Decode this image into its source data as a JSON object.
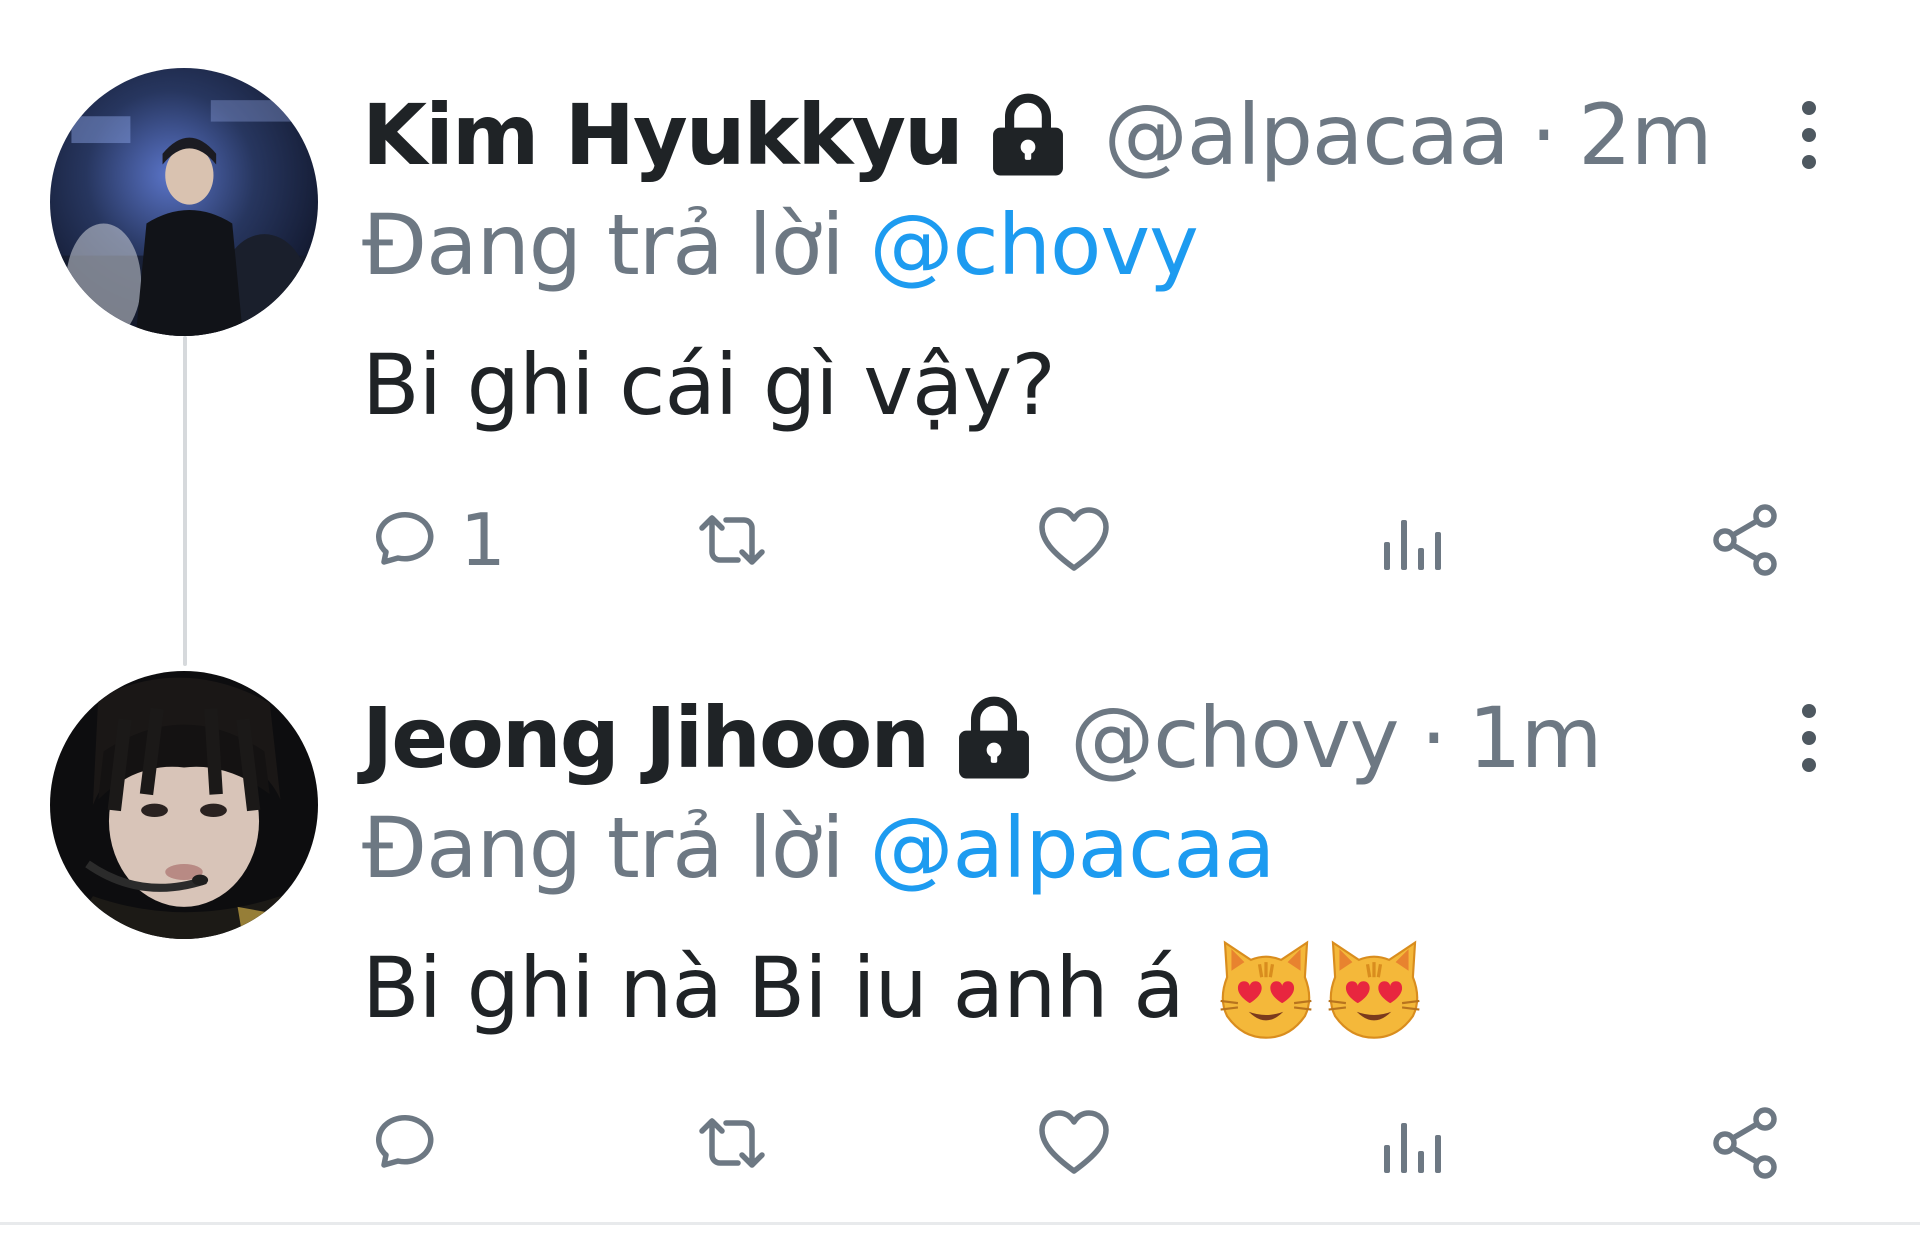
{
  "tweets": [
    {
      "display_name": "Kim Hyukkyu",
      "handle": "@alpacaa",
      "separator": "·",
      "time": "2m",
      "reply_prefix": "Đang trả lời",
      "reply_to": "@chovy",
      "text": "Bi ghi cái gì vậy?",
      "emoji": [],
      "reply_count": "1",
      "icons": [
        "lock-icon",
        "more-vertical-icon",
        "reply-icon",
        "retweet-icon",
        "like-icon",
        "views-icon",
        "share-icon"
      ]
    },
    {
      "display_name": "Jeong Jihoon",
      "handle": "@chovy",
      "separator": "·",
      "time": "1m",
      "reply_prefix": "Đang trả lời",
      "reply_to": "@alpacaa",
      "text": "Bi ghi nà Bi iu anh á",
      "emoji": [
        "heart-eyes-cat-emoji",
        "heart-eyes-cat-emoji"
      ],
      "reply_count": "",
      "icons": [
        "lock-icon",
        "more-vertical-icon",
        "reply-icon",
        "retweet-icon",
        "like-icon",
        "views-icon",
        "share-icon"
      ]
    }
  ],
  "colors": {
    "name": "#1f2326",
    "muted": "#6d7883",
    "mention": "#1d9bf0",
    "thread_line": "#d6d9dc"
  }
}
